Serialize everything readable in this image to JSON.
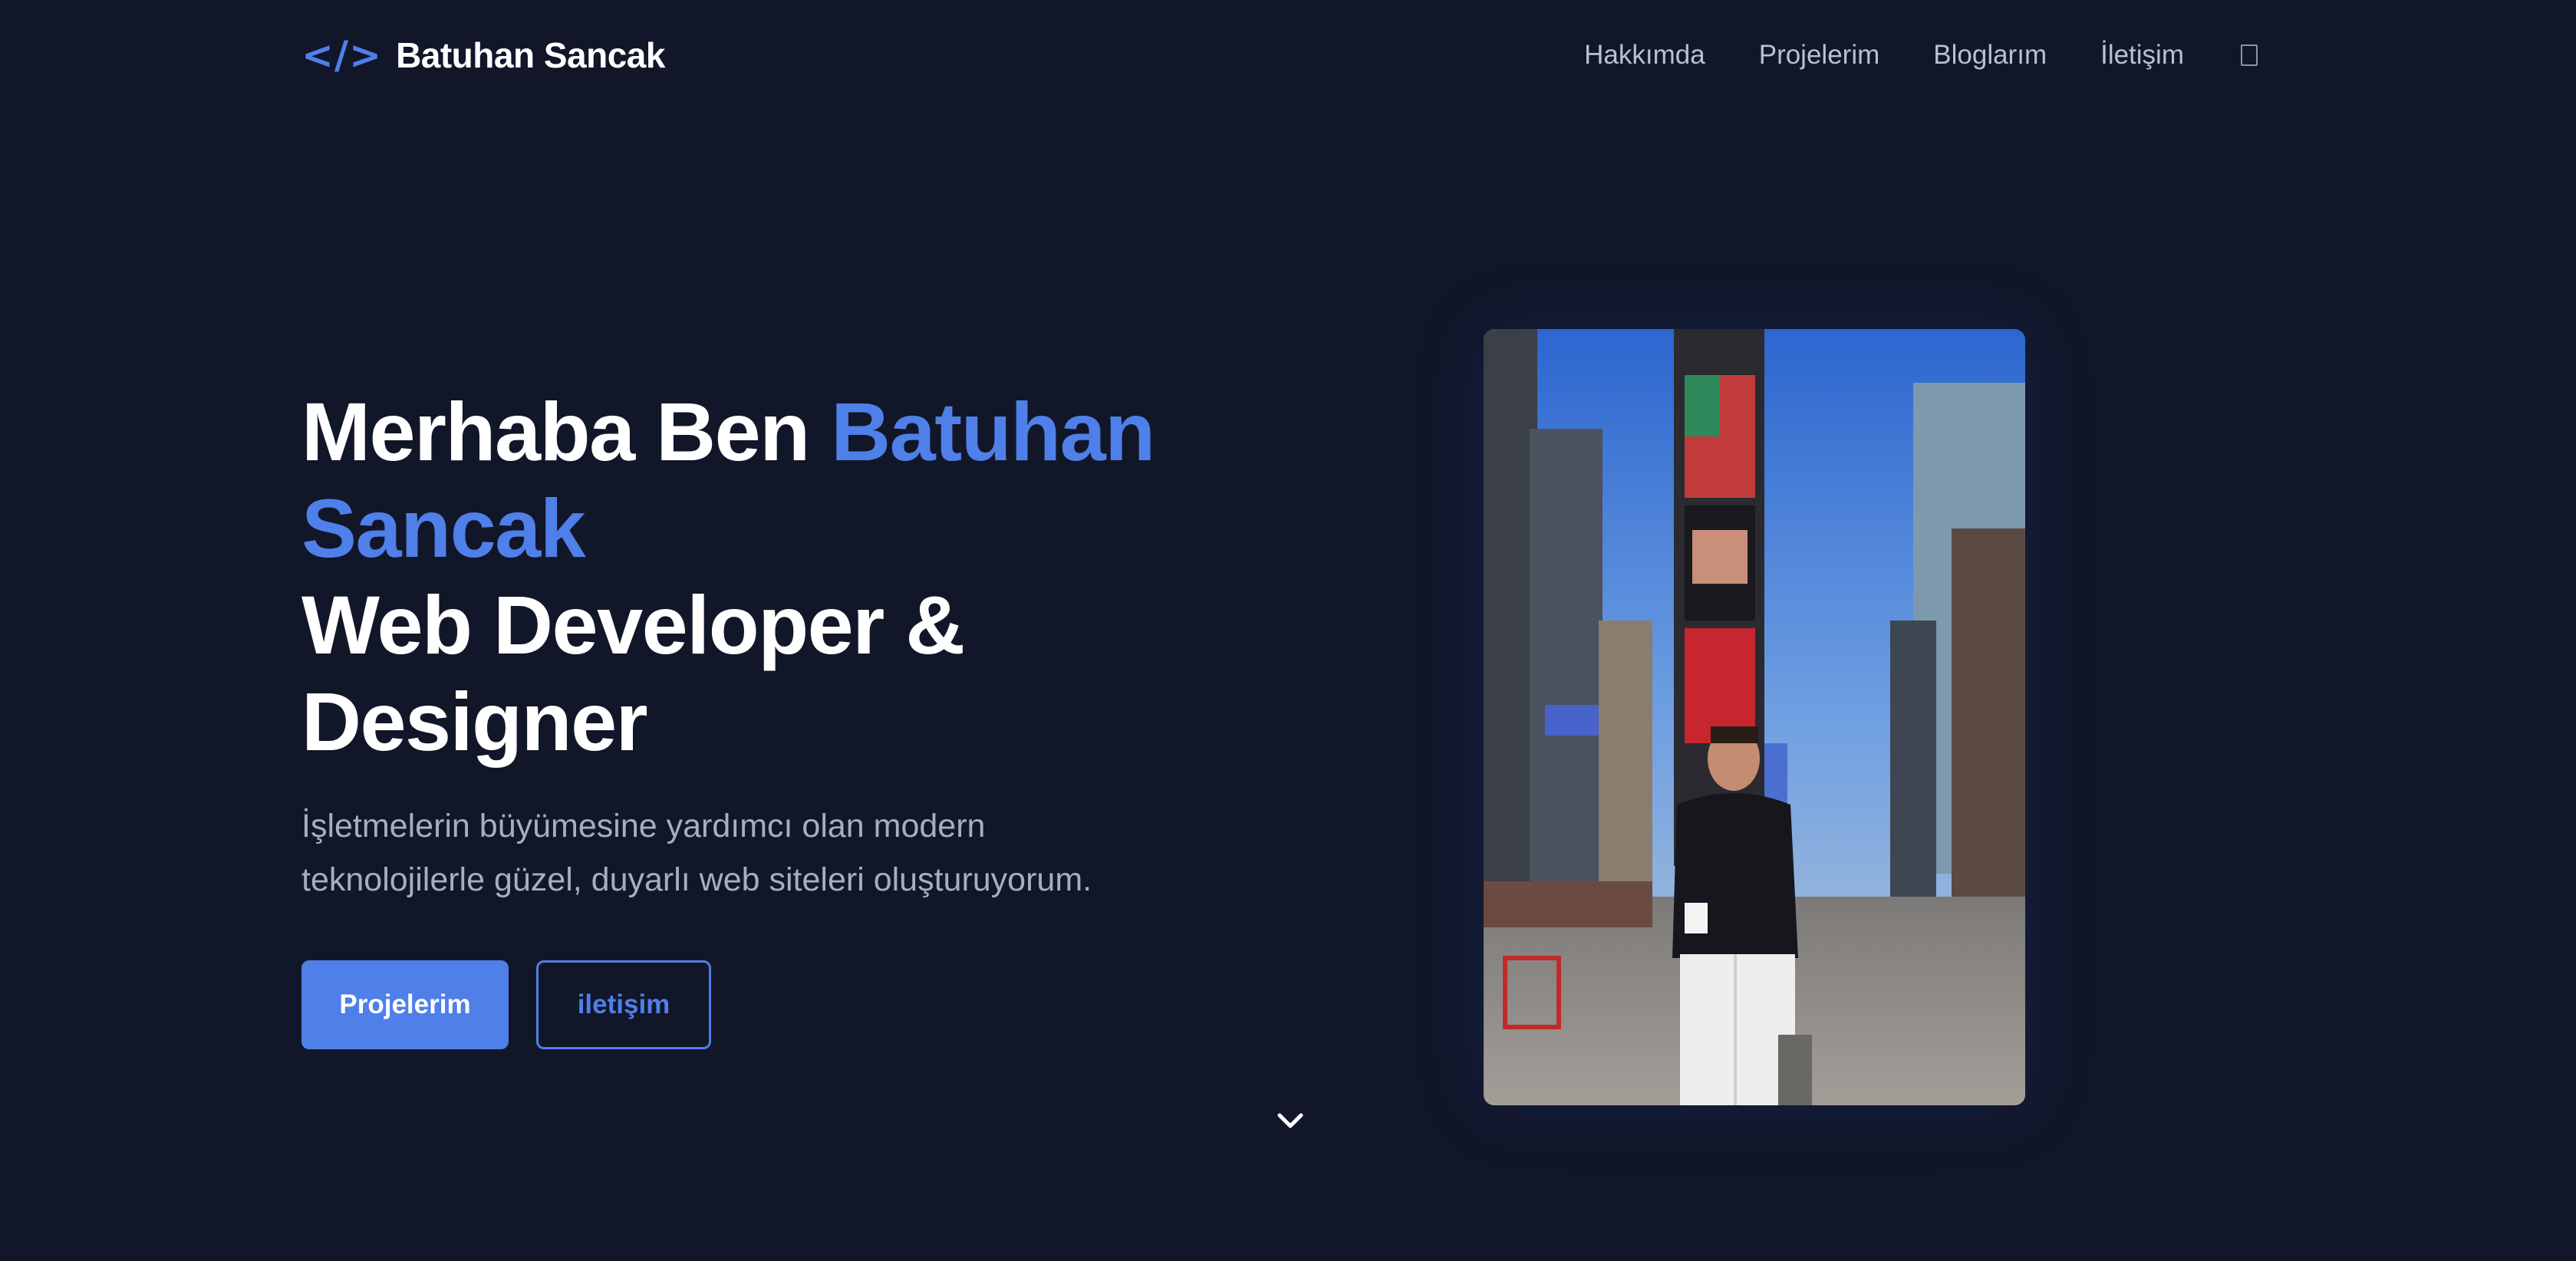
{
  "nav": {
    "brand_code": "</>",
    "brand_name": "Batuhan Sancak",
    "links": [
      {
        "label": "Hakkımda"
      },
      {
        "label": "Projelerim"
      },
      {
        "label": "Bloglarım"
      },
      {
        "label": "İletişim"
      }
    ],
    "theme_toggle_icon": "square-icon"
  },
  "hero": {
    "greeting": "Merhaba Ben ",
    "name_first": "Batuhan",
    "name_last": "Sancak",
    "role_line1": "Web Developer &",
    "role_line2": "Designer",
    "subtitle_line1": "İşletmelerin büyümesine yardımcı olan modern",
    "subtitle_line2": "teknolojilerle güzel, duyarlı web siteleri oluşturuyorum.",
    "primary_button": "Projelerim",
    "secondary_button": "iletişim"
  },
  "scroll_cue_icon": "chevron-down-icon",
  "colors": {
    "background": "#121629",
    "accent": "#4f7fe8",
    "text": "#ffffff",
    "muted": "#a6aec0"
  }
}
